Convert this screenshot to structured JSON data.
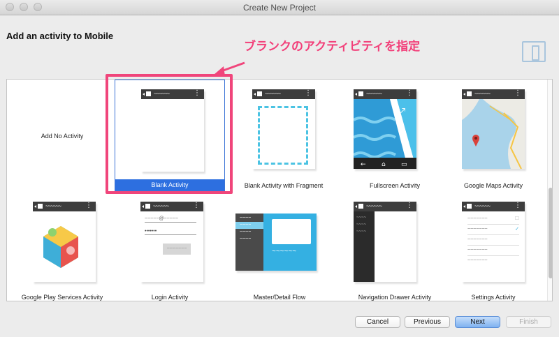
{
  "window": {
    "title": "Create New Project"
  },
  "header": {
    "title": "Add an activity to Mobile"
  },
  "annotation": {
    "text": "ブランクのアクティビティを指定"
  },
  "thumb_bar": {
    "wave": "~~~~~~",
    "dots": "⋮"
  },
  "activities": {
    "none": {
      "label": "Add No Activity"
    },
    "blank": {
      "label": "Blank Activity"
    },
    "blank_fragment": {
      "label": "Blank Activity with Fragment"
    },
    "fullscreen": {
      "label": "Fullscreen Activity"
    },
    "maps": {
      "label": "Google Maps Activity"
    },
    "play_services": {
      "label": "Google Play Services Activity"
    },
    "login": {
      "label": "Login Activity",
      "email_wave": "~~~~~@~~~~~",
      "password_dots": "•••••••",
      "button_wave": "~~~~~~~"
    },
    "master_detail": {
      "label": "Master/Detail Flow"
    },
    "nav_drawer": {
      "label": "Navigation Drawer Activity"
    },
    "settings": {
      "label": "Settings Activity"
    }
  },
  "buttons": {
    "cancel": "Cancel",
    "previous": "Previous",
    "next": "Next",
    "finish": "Finish"
  },
  "colors": {
    "annotation": "#f2407a",
    "selection": "#2d6fe0",
    "thumb_bar": "#3d3d3d",
    "accent_blue": "#33aee0"
  }
}
